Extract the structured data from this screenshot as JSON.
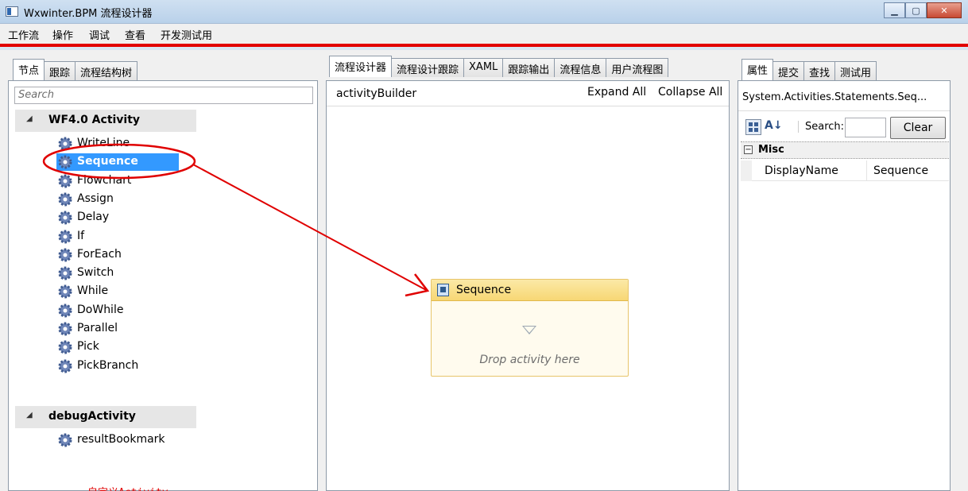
{
  "window": {
    "title": "Wxwinter.BPM 流程设计器"
  },
  "menu": [
    "工作流",
    "操作",
    "调试",
    "查看",
    "开发测试用"
  ],
  "left": {
    "tabs": [
      "节点",
      "跟踪",
      "流程结构树"
    ],
    "search_placeholder": "Search",
    "groups": [
      {
        "name": "WF4.0 Activity",
        "items": [
          "WriteLine",
          "Sequence",
          "Flowchart",
          "Assign",
          "Delay",
          "If",
          "ForEach",
          "Switch",
          "While",
          "DoWhile",
          "Parallel",
          "Pick",
          "PickBranch"
        ]
      },
      {
        "name": "debugActivity",
        "items": [
          "resultBookmark"
        ]
      }
    ],
    "selected_item": "Sequence",
    "annotation": "自定义Activity"
  },
  "center": {
    "tabs": [
      "流程设计器",
      "流程设计跟踪",
      "XAML",
      "跟踪输出",
      "流程信息",
      "用户流程图"
    ],
    "breadcrumb": "activityBuilder",
    "expand_all": "Expand All",
    "collapse_all": "Collapse All",
    "sequence": {
      "title": "Sequence",
      "drop_text": "Drop activity here"
    }
  },
  "right": {
    "tabs": [
      "属性",
      "提交",
      "查找",
      "测试用"
    ],
    "type_name": "System.Activities.Statements.Seq...",
    "search_label": "Search:",
    "search_value": "",
    "clear_label": "Clear",
    "category": "Misc",
    "property_name": "DisplayName",
    "property_value": "Sequence"
  },
  "colors": {
    "menu_accent": "#e20000",
    "selection": "#3399ff",
    "annotation": "#e00000"
  }
}
